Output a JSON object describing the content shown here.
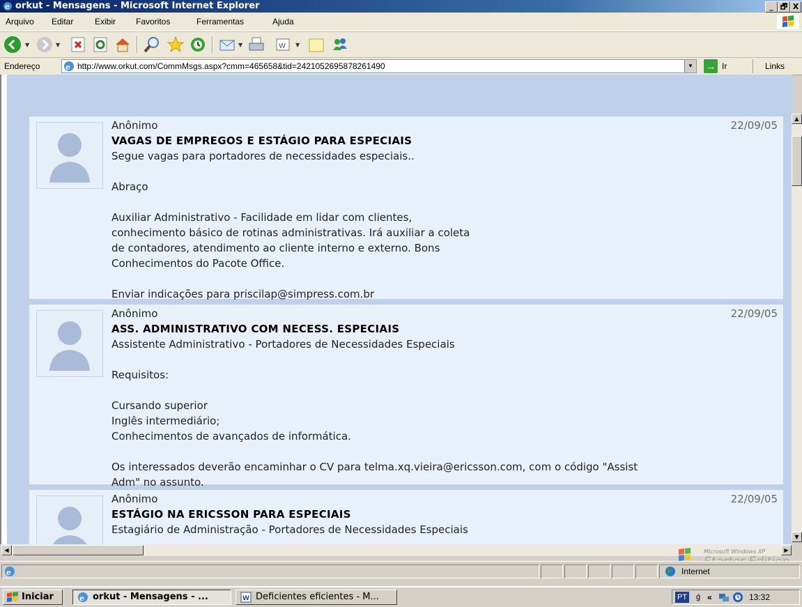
{
  "window": {
    "title": "orkut - Mensagens - Microsoft Internet Explorer",
    "buttons": [
      "_",
      "🗗",
      "X"
    ]
  },
  "menu": [
    "Arquivo",
    "Editar",
    "Exibir",
    "Favoritos",
    "Ferramentas",
    "Ajuda"
  ],
  "toolbar": {
    "icons": [
      "back-icon",
      "forward-icon",
      "stop-icon",
      "refresh-icon",
      "home-icon",
      "search-icon",
      "favorites-icon",
      "history-icon",
      "mail-icon",
      "print-icon",
      "edit-icon",
      "discuss-icon",
      "messenger-icon"
    ]
  },
  "address": {
    "label": "Endereço",
    "url": "http://www.orkut.com/CommMsgs.aspx?cmm=465658&tid=2421052695878261490",
    "go_label": "Ir",
    "links_label": "Links"
  },
  "messages": [
    {
      "author": "Anônimo",
      "date": "22/09/05",
      "title": "VAGAS DE EMPREGOS E ESTÁGIO PARA ESPECIAIS",
      "lines": [
        "Segue vagas para portadores de necessidades especiais..",
        "",
        "Abraço",
        "",
        "Auxiliar Administrativo - Facilidade em lidar com clientes,",
        "conhecimento básico de rotinas administrativas. Irá auxiliar a coleta",
        "de contadores, atendimento ao cliente interno e externo. Bons",
        "Conhecimentos do Pacote Office.",
        "",
        "Enviar indicações para priscilap@simpress.com.br"
      ]
    },
    {
      "author": "Anônimo",
      "date": "22/09/05",
      "title": "ASS. ADMINISTRATIVO COM NECESS. ESPECIAIS",
      "lines": [
        "Assistente Administrativo - Portadores de Necessidades Especiais",
        "",
        "Requisitos:",
        "",
        "Cursando superior",
        "Inglês intermediário;",
        "Conhecimentos de avançados de informática.",
        "",
        "Os interessados deverão encaminhar o CV para telma.xq.vieira@ericsson.com, com o código \"Assist",
        "Adm\" no assunto."
      ]
    },
    {
      "author": "Anônimo",
      "date": "22/09/05",
      "title": "ESTÁGIO NA ERICSSON PARA ESPECIAIS",
      "lines": [
        "Estagiário de Administração - Portadores de Necessidades Especiais"
      ]
    }
  ],
  "status": {
    "zone": "Internet",
    "watermark_line1": "Microsoft Windows XP",
    "watermark_line2": "Starter Edition"
  },
  "taskbar": {
    "start": "Iniciar",
    "tasks": [
      "orkut - Mensagens - ...",
      "Deficientes eficientes - M..."
    ],
    "lang": "PT",
    "time": "13:32"
  }
}
